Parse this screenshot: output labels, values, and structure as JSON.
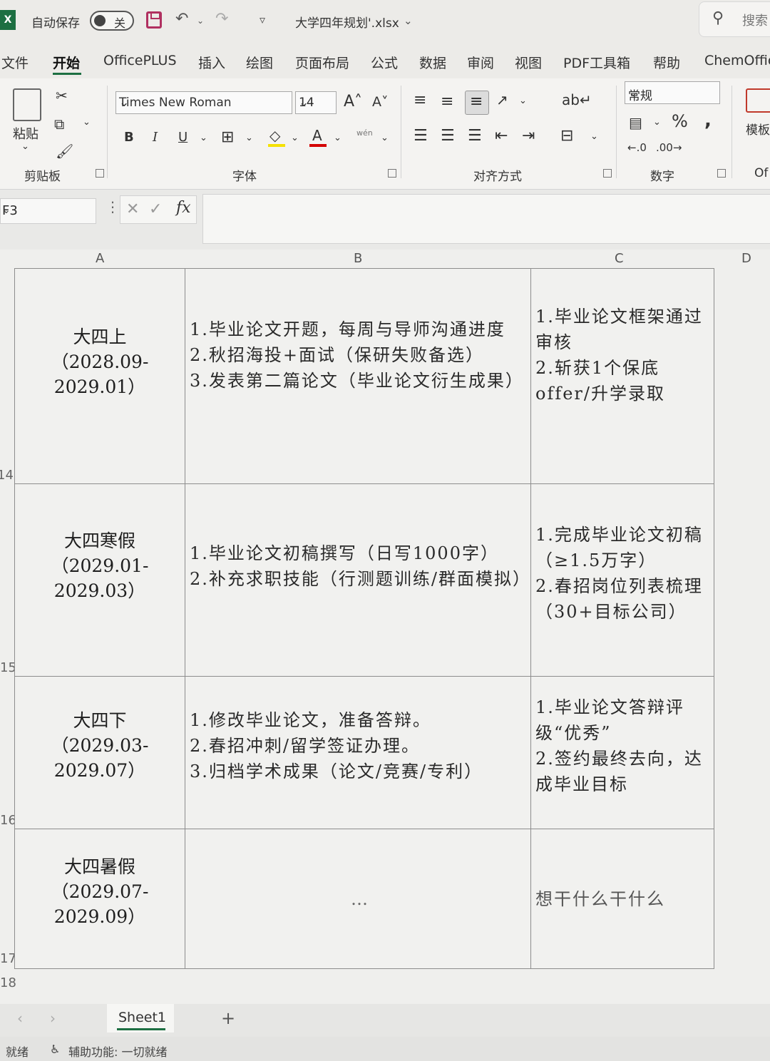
{
  "titlebar": {
    "autosave_label": "自动保存",
    "autosave_state": "关",
    "document_title": "大学四年规划'.xlsx",
    "search_label": "搜索"
  },
  "menu": {
    "items": [
      "文件",
      "开始",
      "OfficePLUS",
      "插入",
      "绘图",
      "页面布局",
      "公式",
      "数据",
      "审阅",
      "视图",
      "PDF工具箱",
      "帮助",
      "ChemOffic"
    ]
  },
  "ribbon": {
    "clipboard": {
      "paste_label": "粘贴",
      "group_label": "剪贴板"
    },
    "font": {
      "font_name": "Times New Roman",
      "font_size": "14",
      "group_label": "字体",
      "bold": "B",
      "italic": "I",
      "underline": "U",
      "wen": "wén"
    },
    "alignment": {
      "group_label": "对齐方式"
    },
    "number": {
      "format": "常规",
      "group_label": "数字",
      "percent": "%"
    },
    "templates": {
      "label": "模板",
      "group_label": "Of"
    }
  },
  "formula_bar": {
    "name_box": "F3",
    "fx": "fx",
    "content": ""
  },
  "sheet": {
    "columns": [
      "A",
      "B",
      "C",
      "D"
    ],
    "row_numbers": [
      "14",
      "15",
      "16",
      "17",
      "18"
    ],
    "rows": [
      {
        "a": [
          "大四上",
          "（2028.09-",
          "2029.01）"
        ],
        "b": [
          "1.毕业论文开题，每周与导师沟通进度",
          "2.秋招海投+面试（保研失败备选）",
          "3.发表第二篇论文（毕业论文衍生成果）"
        ],
        "c": [
          "1.毕业论文框架通过审核",
          "2.斩获1个保底offer/升学录取"
        ]
      },
      {
        "a": [
          "大四寒假",
          "（2029.01-",
          "2029.03）"
        ],
        "b": [
          "1.毕业论文初稿撰写（日写1000字）",
          "2.补充求职技能（行测题训练/群面模拟）"
        ],
        "c": [
          "1.完成毕业论文初稿（≥1.5万字）",
          "2.春招岗位列表梳理（30+目标公司）"
        ]
      },
      {
        "a": [
          "大四下",
          "（2029.03-",
          "2029.07）"
        ],
        "b": [
          "1.修改毕业论文，准备答辩。",
          "2.春招冲刺/留学签证办理。",
          "3.归档学术成果（论文/竞赛/专利）"
        ],
        "c": [
          "1.毕业论文答辩评级“优秀”",
          "2.签约最终去向，达成毕业目标"
        ]
      },
      {
        "a": [
          "大四暑假",
          "（2029.07-",
          "2029.09）"
        ],
        "b": [
          "…"
        ],
        "c": [
          "想干什么干什么"
        ]
      }
    ]
  },
  "sheet_tabs": {
    "active": "Sheet1",
    "add": "+"
  },
  "status": {
    "ready": "就绪",
    "accessibility": "辅助功能: 一切就绪"
  },
  "colors": {
    "excel_green": "#1d6f42",
    "save_icon": "#b03060",
    "font_color_bar": "#d40000",
    "highlight_bar": "#f5e100"
  }
}
